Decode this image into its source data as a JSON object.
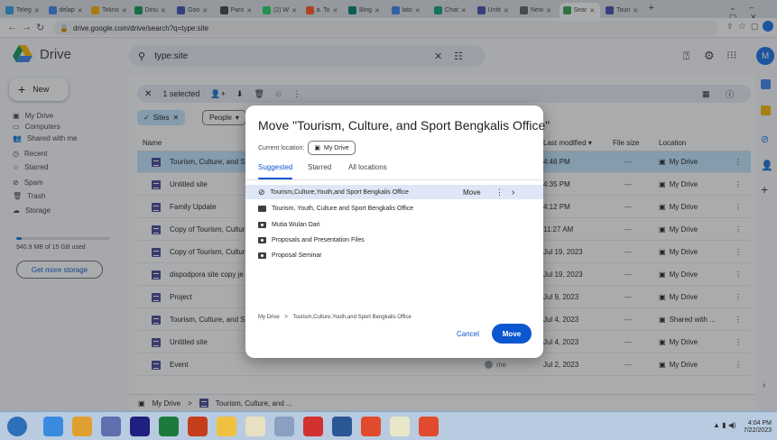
{
  "browser": {
    "tabs": [
      {
        "label": "Teleg",
        "color": "#2aa3df"
      },
      {
        "label": "delap",
        "color": "#4285f4"
      },
      {
        "label": "Tekno",
        "color": "#f5b400"
      },
      {
        "label": "Dinu",
        "color": "#0f9d58"
      },
      {
        "label": "Goo",
        "color": "#3f51b5"
      },
      {
        "label": "Paro",
        "color": "#444444"
      },
      {
        "label": "(2) W",
        "color": "#25d366"
      },
      {
        "label": "a. To",
        "color": "#ff5722"
      },
      {
        "label": "Bing",
        "color": "#008373"
      },
      {
        "label": "lato",
        "color": "#4285f4"
      },
      {
        "label": "Chat",
        "color": "#10a37f"
      },
      {
        "label": "Untit",
        "color": "#3f51b5"
      },
      {
        "label": "New",
        "color": "#5f6368"
      },
      {
        "label": "Sear",
        "color": "#34a853",
        "active": true
      },
      {
        "label": "Touri",
        "color": "#3f51b5"
      }
    ],
    "new_tab": "+",
    "url": "drive.google.com/drive/search?q=type:site"
  },
  "drive": {
    "app_name": "Drive",
    "search_query": "type:site",
    "avatar_letter": "M"
  },
  "sidebar": {
    "new_label": "New",
    "items": [
      {
        "label": "My Drive"
      },
      {
        "label": "Computers"
      },
      {
        "label": "Shared with me"
      },
      {
        "label": "Recent"
      },
      {
        "label": "Starred"
      },
      {
        "label": "Spam"
      },
      {
        "label": "Trash"
      },
      {
        "label": "Storage"
      }
    ],
    "storage_text": "940.9 MB of 15 GB used",
    "storage_fraction": 0.06,
    "get_storage": "Get more storage"
  },
  "selection": {
    "label": "1 selected"
  },
  "filters": {
    "sites": "Sites",
    "people": "People"
  },
  "table": {
    "headers": {
      "name": "Name",
      "modified": "Last modified",
      "size": "File size",
      "location": "Location"
    },
    "rows": [
      {
        "name": "Tourism, Culture, and Sp",
        "owner": "",
        "modified": "4:46 PM",
        "size": "—",
        "location": "My Drive",
        "selected": true
      },
      {
        "name": "Untitled site",
        "owner": "",
        "modified": "4:35 PM",
        "size": "—",
        "location": "My Drive"
      },
      {
        "name": "Family Update",
        "owner": "",
        "modified": "4:12 PM",
        "size": "—",
        "location": "My Drive"
      },
      {
        "name": "Copy of Tourism, Culture",
        "owner": "",
        "modified": "11:27 AM",
        "size": "—",
        "location": "My Drive"
      },
      {
        "name": "Copy of Tourism, Culture",
        "owner": "",
        "modified": "Jul 19, 2023",
        "size": "—",
        "location": "My Drive"
      },
      {
        "name": "dispodpora site copy je",
        "owner": "",
        "modified": "Jul 19, 2023",
        "size": "—",
        "location": "My Drive"
      },
      {
        "name": "Project",
        "owner": "",
        "modified": "Jul 9, 2023",
        "size": "—",
        "location": "My Drive"
      },
      {
        "name": "Tourism, Culture, and Sp",
        "owner": "",
        "modified": "Jul 4, 2023",
        "size": "—",
        "location": "Shared with ..."
      },
      {
        "name": "Untitled site",
        "owner": "",
        "modified": "Jul 4, 2023",
        "size": "—",
        "location": "My Drive"
      },
      {
        "name": "Event",
        "owner": "me",
        "modified": "Jul 2, 2023",
        "size": "—",
        "location": "My Drive"
      }
    ]
  },
  "breadcrumb": {
    "root": "My Drive",
    "separator": ">",
    "current": "Tourism, Culture, and ..."
  },
  "dialog": {
    "title": "Move \"Tourism, Culture, and Sport Bengkalis Office\"",
    "current_location_label": "Current location:",
    "current_location": "My Drive",
    "tabs": [
      "Suggested",
      "Starred",
      "All locations"
    ],
    "items": [
      {
        "label": "Tourism,Culture,Youth,and Sport Bengkalis Office",
        "kind": "check",
        "highlighted": true,
        "action": "Move"
      },
      {
        "label": "Tourism, Youth, Culture and Sport Bengkalis Office",
        "kind": "folder"
      },
      {
        "label": "Mutia Wulan Dari",
        "kind": "shared"
      },
      {
        "label": "Proposals and Presentation Files",
        "kind": "shared"
      },
      {
        "label": "Proposal Seminar",
        "kind": "shared"
      }
    ],
    "path_root": "My Drive",
    "path_sep": ">",
    "path_target": "Tourism,Culture,Youth,and Sport Bengkalis Office",
    "cancel": "Cancel",
    "move": "Move"
  },
  "taskbar": {
    "time": "4:04 PM",
    "date": "7/22/2023"
  }
}
